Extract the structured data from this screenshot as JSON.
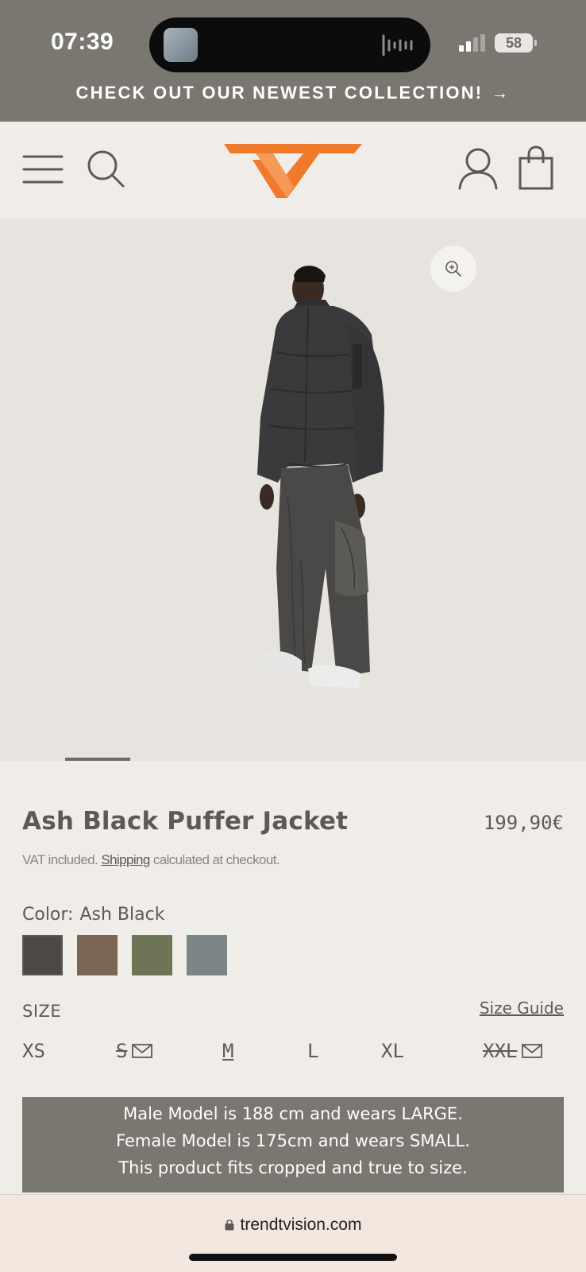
{
  "status_bar": {
    "time": "07:39",
    "battery": "58"
  },
  "promo": {
    "text": "CHECK OUT OUR NEWEST COLLECTION!",
    "arrow": "→"
  },
  "header": {
    "icons": [
      "menu-icon",
      "search-icon",
      "logo",
      "account-icon",
      "cart-icon"
    ],
    "logo_color": "#f07a2c"
  },
  "gallery": {
    "image": "Model wearing Ash Black Puffer Jacket",
    "slide_index": 1
  },
  "product": {
    "title": "Ash Black Puffer Jacket",
    "price": "199,90€",
    "vat_prefix": "VAT included.",
    "shipping_link": "Shipping",
    "vat_suffix": "calculated at checkout.",
    "color_label": "Color:",
    "color_value": "Ash Black",
    "swatches": [
      {
        "name": "Ash Black",
        "color": "#4d4846",
        "selected": true
      },
      {
        "name": "Brown",
        "color": "#7b6555",
        "selected": false
      },
      {
        "name": "Olive",
        "color": "#6e7556",
        "selected": false
      },
      {
        "name": "Grey",
        "color": "#7b8486",
        "selected": false
      }
    ],
    "size_label": "SIZE",
    "size_guide": "Size Guide",
    "sizes": [
      {
        "label": "XS",
        "sold_out": false
      },
      {
        "label": "S",
        "sold_out": true
      },
      {
        "label": "M",
        "sold_out": false,
        "selected": true
      },
      {
        "label": "L",
        "sold_out": false
      },
      {
        "label": "XL",
        "sold_out": false
      },
      {
        "label": "XXL",
        "sold_out": true
      }
    ],
    "fit_lines": [
      "Male Model is 188 cm and wears LARGE.",
      "Female Model is 175cm and wears SMALL.",
      "This product fits cropped and true to size."
    ]
  },
  "browser": {
    "url": "trendtvision.com"
  }
}
